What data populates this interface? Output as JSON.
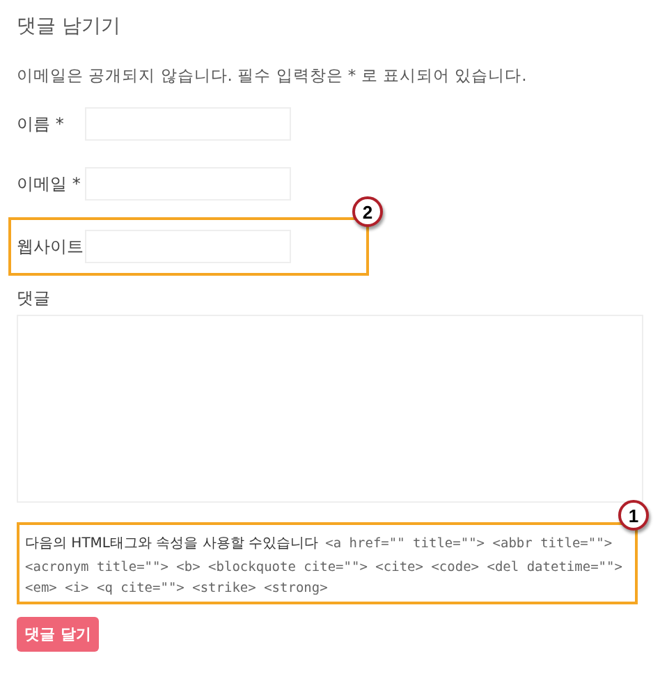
{
  "title": "댓글 남기기",
  "notice": "이메일은 공개되지 않습니다. 필수 입력창은 * 로 표시되어 있습니다.",
  "fields": [
    {
      "label": "이름 *"
    },
    {
      "label": "이메일 *"
    },
    {
      "label": "웹사이트",
      "callout": "2"
    }
  ],
  "comment_label": "댓글",
  "allowed_tags": {
    "intro": "다음의 HTML태그와 속성을 사용할 수있습니다",
    "code": "<a href=\"\" title=\"\"> <abbr title=\"\"> <acronym title=\"\"> <b> <blockquote cite=\"\"> <cite> <code> <del datetime=\"\"> <em> <i> <q cite=\"\"> <strike> <strong>",
    "callout": "1"
  },
  "submit": "댓글 달기"
}
